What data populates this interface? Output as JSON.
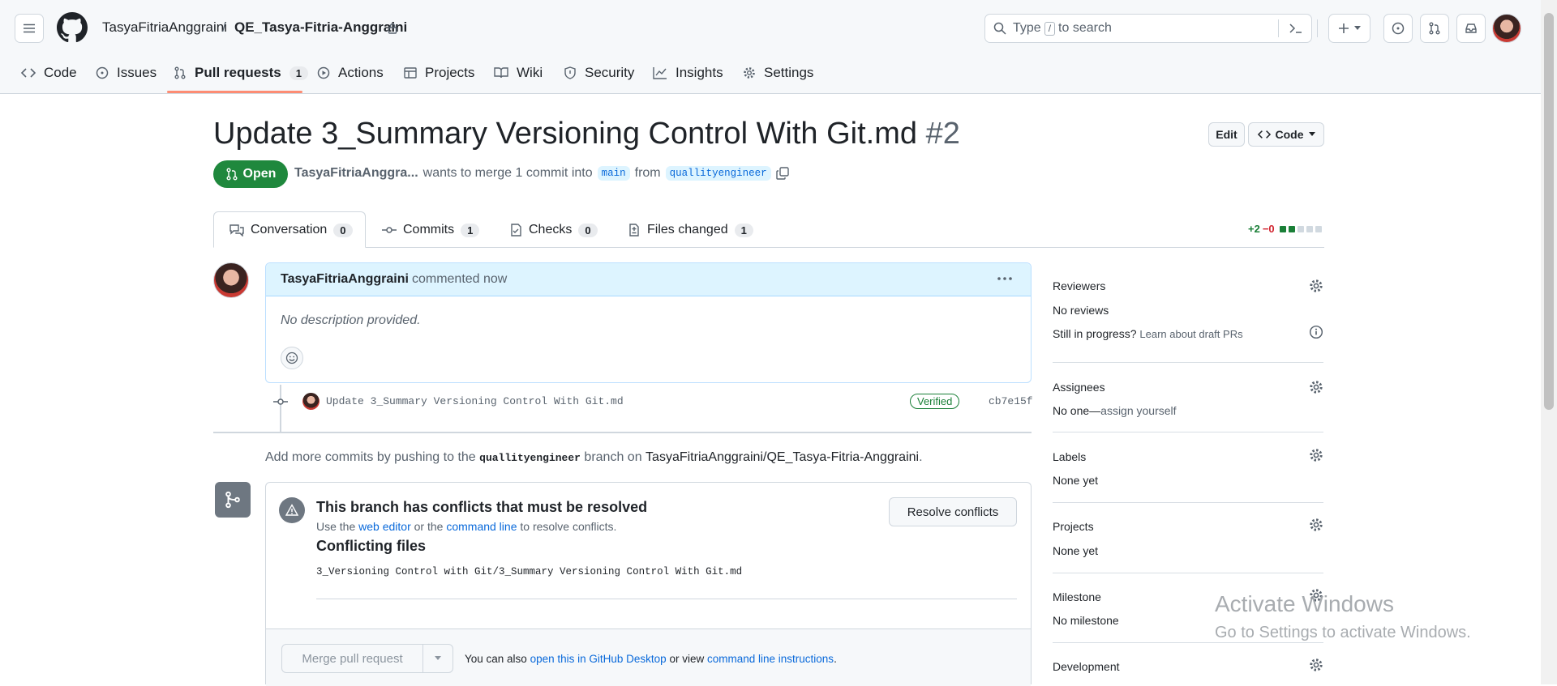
{
  "header": {
    "owner": "TasyaFitriaAnggraini",
    "separator": "/",
    "repo": "QE_Tasya-Fitria-Anggraini",
    "search_prefix": "Type",
    "search_key": "/",
    "search_suffix": "to search"
  },
  "nav": {
    "tabs": [
      {
        "label": "Code"
      },
      {
        "label": "Issues"
      },
      {
        "label": "Pull requests",
        "count": "1"
      },
      {
        "label": "Actions"
      },
      {
        "label": "Projects"
      },
      {
        "label": "Wiki"
      },
      {
        "label": "Security"
      },
      {
        "label": "Insights"
      },
      {
        "label": "Settings"
      }
    ]
  },
  "pr": {
    "title": "Update 3_Summary Versioning Control With Git.md",
    "number": "#2",
    "state": "Open",
    "author": "TasyaFitriaAnggra...",
    "merge_text": "wants to merge 1 commit into",
    "base": "main",
    "from_text": "from",
    "head": "quallityengineer",
    "edit_label": "Edit",
    "code_label": "Code"
  },
  "pr_tabs": [
    {
      "label": "Conversation",
      "count": "0"
    },
    {
      "label": "Commits",
      "count": "1"
    },
    {
      "label": "Checks",
      "count": "0"
    },
    {
      "label": "Files changed",
      "count": "1"
    }
  ],
  "diffstat": {
    "added": "+2",
    "removed": "−0"
  },
  "comment": {
    "author": "TasyaFitriaAnggraini",
    "action": "commented now",
    "body": "No description provided."
  },
  "commit": {
    "message": "Update 3_Summary Versioning Control With Git.md",
    "verified": "Verified",
    "sha": "cb7e15f"
  },
  "push_hint": {
    "prefix": "Add more commits by pushing to the",
    "branch": "quallityengineer",
    "middle": "branch on",
    "repo": "TasyaFitriaAnggraini/QE_Tasya-Fitria-Anggraini",
    "suffix": "."
  },
  "merge_box": {
    "conflict_title": "This branch has conflicts that must be resolved",
    "use_the": "Use the",
    "web_editor": "web editor",
    "or_the": "or the",
    "command_line": "command line",
    "to_resolve": "to resolve conflicts.",
    "resolve_label": "Resolve conflicts",
    "conflicting_title": "Conflicting files",
    "file": "3_Versioning Control with Git/3_Summary Versioning Control With Git.md",
    "merge_label": "Merge pull request",
    "also_prefix": "You can also",
    "desktop_link": "open this in GitHub Desktop",
    "or_view": "or view",
    "cli_link": "command line instructions",
    "period": "."
  },
  "sidebar": {
    "reviewers": {
      "title": "Reviewers",
      "value": "No reviews",
      "draft_prefix": "Still in progress?",
      "draft_link": "Learn about draft PRs"
    },
    "assignees": {
      "title": "Assignees",
      "value_prefix": "No one—",
      "value_link": "assign yourself"
    },
    "labels": {
      "title": "Labels",
      "value": "None yet"
    },
    "projects": {
      "title": "Projects",
      "value": "None yet"
    },
    "milestone": {
      "title": "Milestone",
      "value": "No milestone"
    },
    "development": {
      "title": "Development"
    }
  },
  "watermark": {
    "line1": "Activate Windows",
    "line2": "Go to Settings to activate Windows."
  },
  "colors": {
    "accent": "#0969da",
    "open_green": "#1f883d",
    "active_tab": "#fd8c73"
  }
}
